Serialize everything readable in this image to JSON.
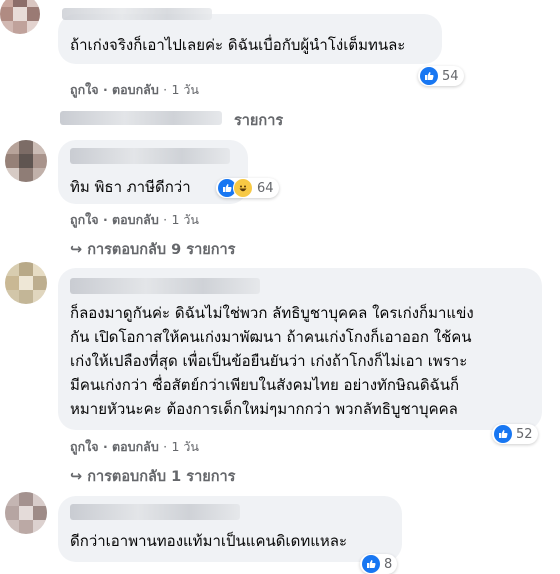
{
  "comments": [
    {
      "text": [
        "ถ้าเก่งจริงก็เอาไปเลยค่ะ ดิฉันเบื่อกับผู้นำโง่เต็มทนละ"
      ],
      "like_label": "ถูกใจ",
      "reply_label": "ตอบกลับ",
      "time": "1 วัน",
      "reaction_count": "54"
    },
    {
      "text": [
        "ทิม พิธา ภาษีดีกว่า"
      ],
      "like_label": "ถูกใจ",
      "reply_label": "ตอบกลับ",
      "time": "1 วัน",
      "reaction_count": "64"
    },
    {
      "text": [
        "ก็ลองมาดูกันค่ะ ดิฉันไม่ใช่พวก ลัทธิบูชาบุคคล ใครเก่งก็มาแข่ง",
        "กัน เปิดโอกาสให้คนเก่งมาพัฒนา ถ้าคนเก่งโกงก็เอาออก ใช้คน",
        "เก่งให้เปลืองที่สุด เพื่อเป็นข้อยืนยันว่า เก่งถ้าโกงก็ไม่เอา เพราะ",
        "มีคนเก่งกว่า ซื่อสัตย์กว่าเพียบในสังคมไทย อย่างทักษิณดิฉันก็",
        "หมายหัวนะคะ ต้องการเด็กใหม่ๆมากกว่า พวกลัทธิบูชาบุคคล"
      ],
      "like_label": "ถูกใจ",
      "reply_label": "ตอบกลับ",
      "time": "1 วัน",
      "reaction_count": "52"
    },
    {
      "text": [
        "ดีกว่าเอาพานทองแท้มาเป็นแคนดิเดทแหละ"
      ],
      "reaction_count": "8"
    }
  ],
  "top_reply_suffix": "รายการ",
  "replies": [
    {
      "label": "การตอบกลับ 9 รายการ"
    },
    {
      "label": "การตอบกลับ 1 รายการ"
    }
  ],
  "separator": "·",
  "reply_arrow": "↪",
  "colors": {
    "bubble": "#f0f2f5",
    "meta": "#65676b",
    "like": "#1877f2"
  }
}
